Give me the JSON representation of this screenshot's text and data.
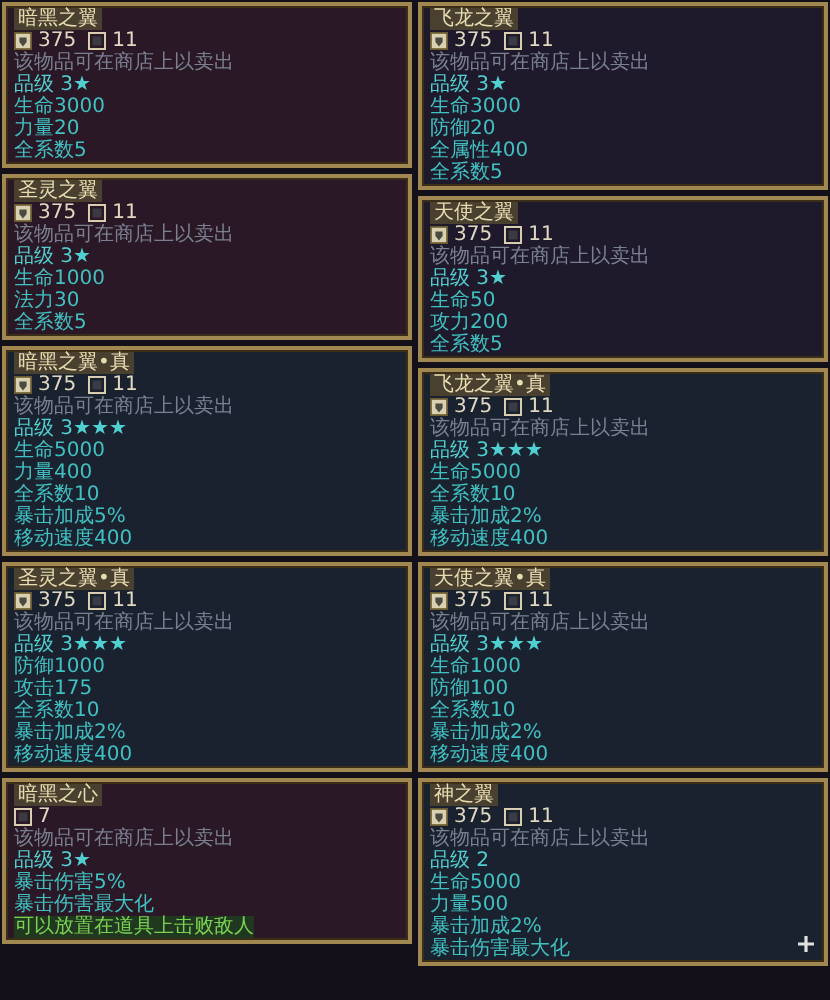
{
  "columns": [
    {
      "cards": [
        {
          "title": "暗黑之翼",
          "color": "#2a1826",
          "level_text": "375",
          "count": "11",
          "notice": "该物品可在商店上以卖出",
          "grade": "品级 3★",
          "lines": [
            {
              "kind": "stat",
              "text": "生命3000"
            },
            {
              "kind": "stat",
              "text": "力量20"
            },
            {
              "kind": "stat",
              "text": "全系数5"
            }
          ]
        },
        {
          "title": "圣灵之翼",
          "color": "#2a1826",
          "level_text": "375",
          "count": "11",
          "notice": "该物品可在商店上以卖出",
          "grade": "品级 3★",
          "lines": [
            {
              "kind": "stat",
              "text": "生命1000"
            },
            {
              "kind": "stat",
              "text": "法力30"
            },
            {
              "kind": "stat",
              "text": "全系数5"
            }
          ]
        },
        {
          "title": "暗黑之翼•真",
          "color": "#1a2230",
          "level_text": "375",
          "count": "11",
          "notice": "该物品可在商店上以卖出",
          "grade": "品级 3★★★",
          "lines": [
            {
              "kind": "stat",
              "text": "生命5000"
            },
            {
              "kind": "stat",
              "text": "力量400"
            },
            {
              "kind": "stat",
              "text": "全系数10"
            },
            {
              "kind": "stat",
              "text": "暴击加成5%"
            },
            {
              "kind": "stat",
              "text": "移动速度400"
            }
          ]
        },
        {
          "title": "圣灵之翼•真",
          "color": "#1a2230",
          "level_text": "375",
          "count": "11",
          "notice": "该物品可在商店上以卖出",
          "grade": "品级 3★★★",
          "lines": [
            {
              "kind": "stat",
              "text": "防御1000"
            },
            {
              "kind": "stat",
              "text": "攻击175"
            },
            {
              "kind": "stat",
              "text": "全系数10"
            },
            {
              "kind": "stat",
              "text": "暴击加成2%"
            },
            {
              "kind": "stat",
              "text": "移动速度400"
            }
          ]
        },
        {
          "title": "暗黑之心",
          "color": "#2a1826",
          "count": "7",
          "notice": "该物品可在商店上以卖出",
          "grade": "品级 3★",
          "lines": [
            {
              "kind": "stat",
              "text": "暴击伤害5%"
            },
            {
              "kind": "stat",
              "text": "暴击伤害最大化"
            },
            {
              "kind": "effect",
              "text": "可以放置在道具上击败敌人"
            }
          ]
        }
      ]
    },
    {
      "cards": [
        {
          "title": "飞龙之翼",
          "color": "#1e1a2c",
          "level_text": "375",
          "count": "11",
          "notice": "该物品可在商店上以卖出",
          "grade": "品级 3★",
          "lines": [
            {
              "kind": "stat",
              "text": "生命3000"
            },
            {
              "kind": "stat",
              "text": "防御20"
            },
            {
              "kind": "stat",
              "text": "全属性400"
            },
            {
              "kind": "stat",
              "text": "全系数5"
            }
          ]
        },
        {
          "title": "天使之翼",
          "color": "#1e1a2c",
          "level_text": "375",
          "count": "11",
          "notice": "该物品可在商店上以卖出",
          "grade": "品级 3★",
          "lines": [
            {
              "kind": "stat",
              "text": "生命50"
            },
            {
              "kind": "stat",
              "text": "攻力200"
            },
            {
              "kind": "stat",
              "text": "全系数5"
            }
          ]
        },
        {
          "title": "飞龙之翼•真",
          "color": "#1a2230",
          "level_text": "375",
          "count": "11",
          "notice": "该物品可在商店上以卖出",
          "grade": "品级 3★★★",
          "lines": [
            {
              "kind": "stat",
              "text": "生命5000"
            },
            {
              "kind": "stat",
              "text": "全系数10"
            },
            {
              "kind": "stat",
              "text": "暴击加成2%"
            },
            {
              "kind": "stat",
              "text": "移动速度400"
            }
          ]
        },
        {
          "title": "天使之翼•真",
          "color": "#1a2230",
          "level_text": "375",
          "count": "11",
          "notice": "该物品可在商店上以卖出",
          "grade": "品级 3★★★",
          "lines": [
            {
              "kind": "stat",
              "text": "生命1000"
            },
            {
              "kind": "stat",
              "text": "防御100"
            },
            {
              "kind": "stat",
              "text": "全系数10"
            },
            {
              "kind": "stat",
              "text": "暴击加成2%"
            },
            {
              "kind": "stat",
              "text": "移动速度400"
            }
          ]
        },
        {
          "title": "神之翼",
          "color": "#1a2230",
          "level_text": "375",
          "count": "11",
          "notice": "该物品可在商店上以卖出",
          "grade": "品级 2",
          "lines": [
            {
              "kind": "stat",
              "text": "生命5000"
            },
            {
              "kind": "stat",
              "text": "力量500"
            },
            {
              "kind": "stat",
              "text": "暴击加成2%"
            },
            {
              "kind": "stat",
              "text": "暴击伤害最大化"
            }
          ],
          "expand": true
        }
      ]
    }
  ]
}
